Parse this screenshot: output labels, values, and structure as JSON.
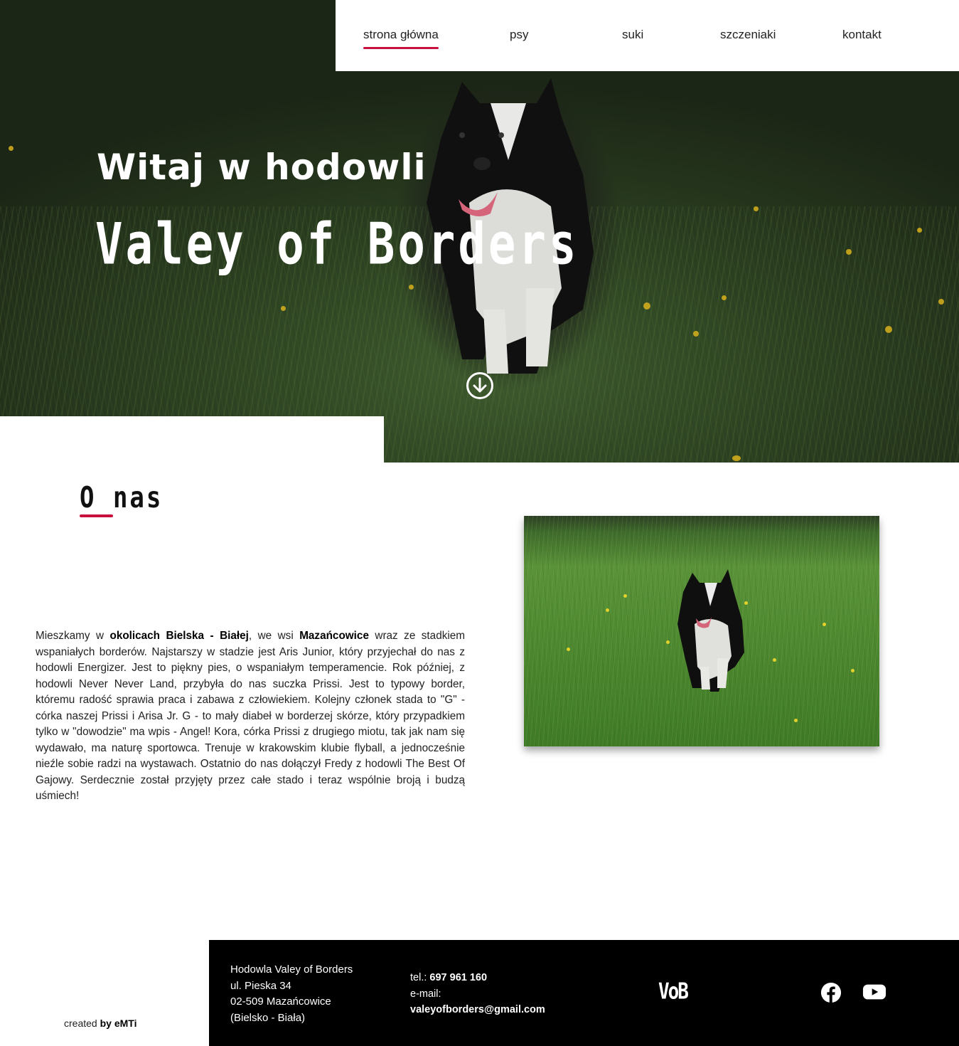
{
  "nav": {
    "items": [
      {
        "label": "strona główna",
        "active": true
      },
      {
        "label": "psy",
        "active": false
      },
      {
        "label": "suki",
        "active": false
      },
      {
        "label": "szczeniaki",
        "active": false
      },
      {
        "label": "kontakt",
        "active": false
      }
    ]
  },
  "hero": {
    "title_line1": "Witaj w hodowli",
    "title_line2": "Valey of Borders",
    "scroll_icon": "arrow-down-circle-icon"
  },
  "about": {
    "heading": "O nas",
    "paragraph": {
      "p1": "Mieszkamy w ",
      "b1": "okolicach Bielska - Białej",
      "p2": ", we wsi ",
      "b2": "Mazańcowice",
      "p3": " wraz ze stadkiem wspaniałych borderów. Najstarszy w stadzie jest Aris Junior, który przyjechał do nas z hodowli Energizer. Jest to piękny pies, o wspaniałym temperamencie. Rok później, z hodowli Never Never Land, przybyła do nas suczka Prissi. Jest to typowy border, któremu radość sprawia praca i zabawa z człowiekiem. Kolejny członek stada to \"G\" - córka naszej Prissi i Arisa Jr. G - to mały diabeł w borderzej skórze, który przypadkiem tylko w \"dowodzie\" ma wpis - Angel! Kora, córka Prissi z drugiego miotu, tak jak nam się wydawało, ma naturę sportowca. Trenuje w krakowskim klubie flyball, a jednocześnie nieźle sobie radzi na wystawach. Ostatnio do nas dołączył Fredy z hodowli The Best Of Gajowy. Serdecznie został przyjęty przez całe stado i teraz wspólnie broją i budzą uśmiech!"
    }
  },
  "credit": {
    "prefix": "created ",
    "by": "by eMTi"
  },
  "footer": {
    "address": [
      "Hodowla Valey of Borders",
      "ul. Pieska 34",
      "02-509 Mazańcowice",
      "(Bielsko - Biała)"
    ],
    "tel_label": "tel.: ",
    "tel_value": "697 961 160",
    "email_label": "e-mail:",
    "email_value": "valeyofborders@gmail.com",
    "logo": "VoB",
    "social": [
      "facebook-icon",
      "youtube-icon"
    ]
  },
  "colors": {
    "accent": "#c8103e",
    "footer_bg": "#000000",
    "nav_bg": "#ffffff"
  }
}
